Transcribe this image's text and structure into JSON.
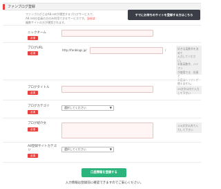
{
  "header": {
    "title": "ファンブログ登録"
  },
  "intro": {
    "lines": [
      "ファンブログとはA8.netが運営するブログサービスで、",
      "A8.netの会員の方のみ利用できるサービスです。当社は",
      "複数サイトの方が運営されます。"
    ],
    "highlight": "当社は"
  },
  "cta_button": {
    "label": "すでにお持ちのサイトを登録する方はこちら"
  },
  "required_label": "必須",
  "fields": {
    "nickname": {
      "label": "ニックネーム"
    },
    "blog_url": {
      "label": "ブログURL",
      "prefix": "http://fanblogs.jp/",
      "suffix": "/",
      "help": [
        "好きな英数字を決めて",
        "入力してください。",
        "半角英数字、ハイフン",
        "が使用でき、先頭と",
        "末尾はハイフンが",
        "使えません。"
      ]
    },
    "blog_title": {
      "label": "ブログタイトル",
      "help": "29文字以内で入力して下さい"
    },
    "blog_category": {
      "label": "ブログカテゴリ",
      "selected": "選択してください"
    },
    "blog_intro": {
      "label": "ブログ紹介文",
      "help": "120文字以内で入力して下さい"
    },
    "a8_category": {
      "label": "A8登録サイトカテゴリ",
      "selected": "選択してください"
    }
  },
  "submit_button": {
    "label": "口座情報を登録する"
  },
  "footer_note": "入力情報は登録前に確認できますのでご安心ください。"
}
